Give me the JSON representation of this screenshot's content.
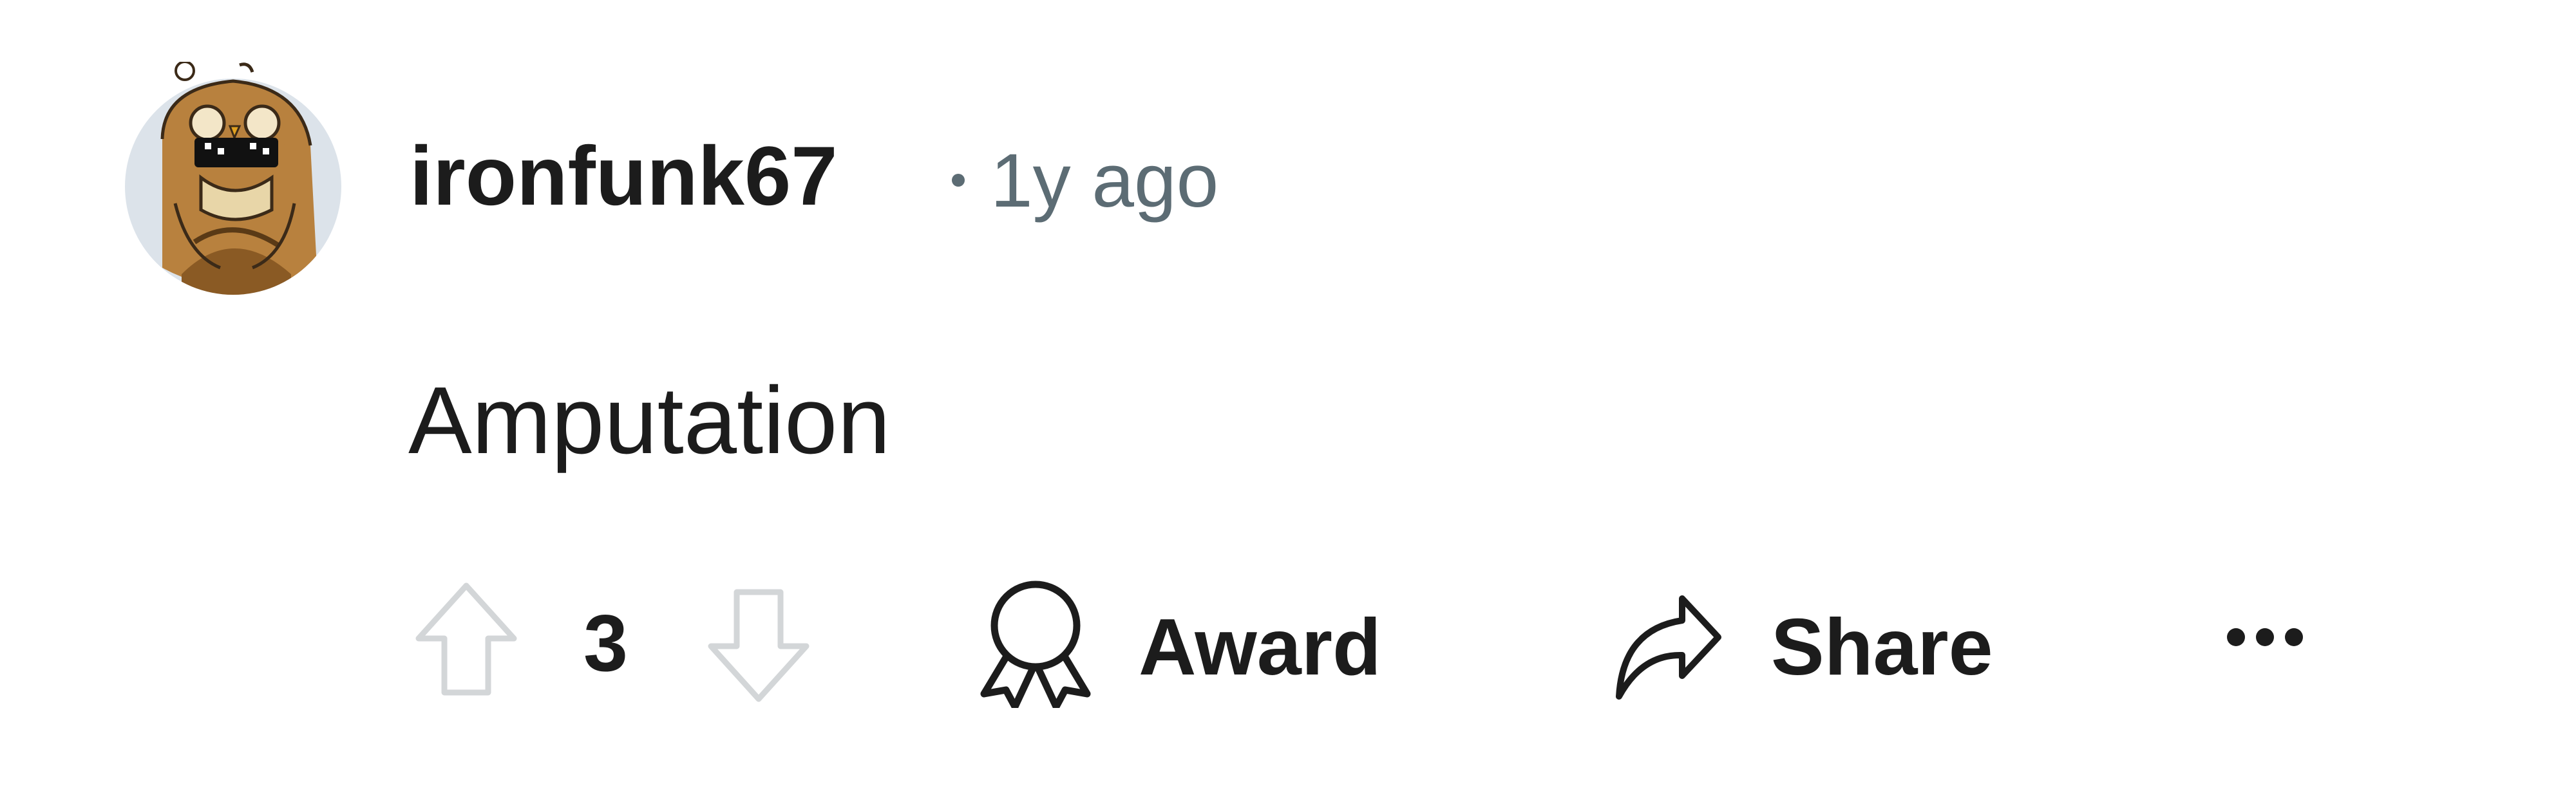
{
  "comment": {
    "author": "ironfunk67",
    "time": "1y ago",
    "body": "Amputation",
    "avatar_icon": "owl-avatar-icon"
  },
  "actions": {
    "upvote_icon": "arrow-up-icon",
    "vote_count": "3",
    "downvote_icon": "arrow-down-icon",
    "award_label": "Award",
    "award_icon": "award-ribbon-icon",
    "share_label": "Share",
    "share_icon": "share-arrow-icon",
    "more_icon": "ellipsis-icon"
  },
  "colors": {
    "text": "#1c1c1c",
    "meta": "#5c6c74",
    "vote_outline": "#d3d6d8"
  }
}
